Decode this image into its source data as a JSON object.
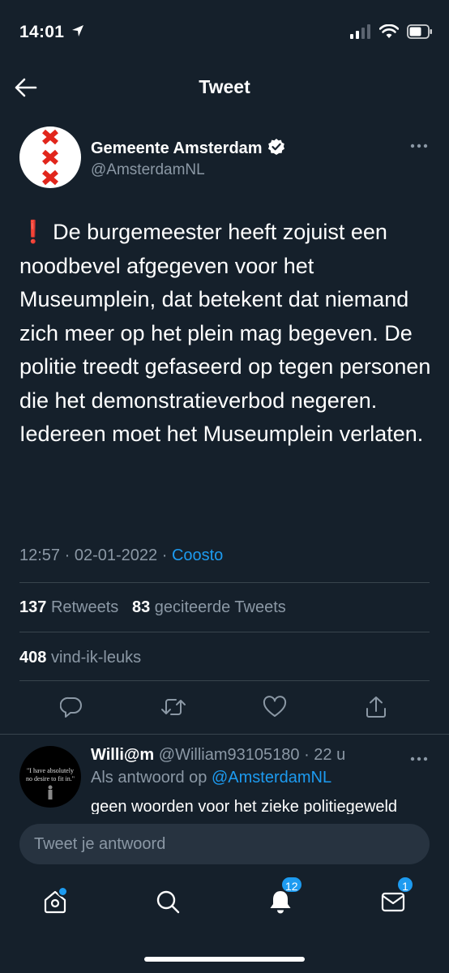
{
  "status_bar": {
    "time": "14:01"
  },
  "header": {
    "title": "Tweet"
  },
  "tweet": {
    "author_name": "Gemeente Amsterdam",
    "author_handle": "@AmsterdamNL",
    "alert_emoji": "❗",
    "text": "De burgemeester heeft zojuist een noodbevel afgegeven voor het Museumplein, dat betekent dat niemand zich meer op het plein mag begeven. De politie treedt gefaseerd op tegen personen die het demonstratieverbod negeren. Iedereen moet het Museumplein verlaten.",
    "time": "12:57",
    "date": "02-01-2022",
    "meta_separator": " · ",
    "source": "Coosto"
  },
  "stats": {
    "retweets_count": "137",
    "retweets_label": "Retweets",
    "quotes_count": "83",
    "quotes_label": "geciteerde Tweets",
    "likes_count": "408",
    "likes_label": "vind-ik-leuks"
  },
  "reply": {
    "name": "Willi@m",
    "handle": "@William93105180",
    "time_ago": "22 u",
    "time_separator": " · ",
    "replying_to_prefix": "Als antwoord op",
    "replying_to": "@AmsterdamNL",
    "text": "geen woorden voor het zieke politiegeweld",
    "avatar_text": "\"I have absolutely no desire to fit in.\""
  },
  "composer": {
    "placeholder": "Tweet je antwoord"
  },
  "tabbar": {
    "notifications_badge": "12",
    "messages_badge": "1"
  },
  "colors": {
    "background": "#15202b",
    "accent": "#1d9bf0",
    "secondary_text": "#8b98a5",
    "divider": "#38444d",
    "amsterdam_red": "#e1261c"
  }
}
